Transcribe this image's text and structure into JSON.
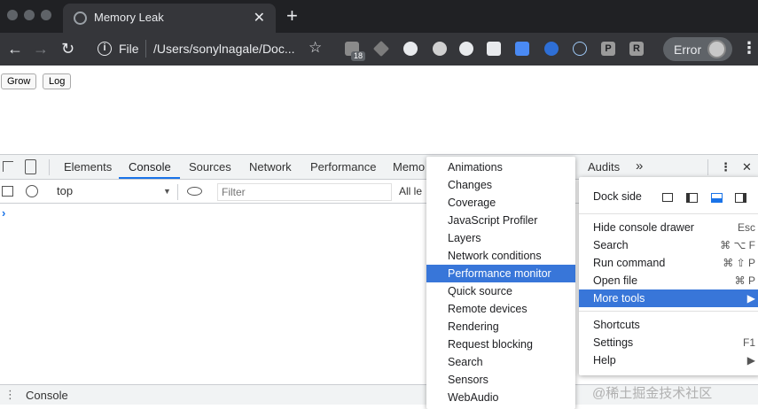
{
  "browser": {
    "tab_title": "Memory Leak",
    "tab_close": "✕",
    "new_tab": "+",
    "nav": {
      "back": "←",
      "forward": "→",
      "reload": "↻"
    },
    "info_icon_glyph": "i",
    "address_scheme": "File",
    "address_url": "/Users/sonylnagale/Doc...",
    "star": "☆",
    "ext_badge": "18",
    "error_label": "Error",
    "menu_glyph": "⋮",
    "extension_letters": [
      "P",
      "R"
    ],
    "colors": {
      "tabbar": "#202124",
      "toolbar": "#35363a"
    }
  },
  "page": {
    "grow_button": "Grow",
    "log_button": "Log"
  },
  "devtools": {
    "tabs": [
      "Elements",
      "Console",
      "Sources",
      "Network",
      "Performance",
      "Memo",
      "Audits"
    ],
    "more_tabs": "»",
    "active_tab": "Console",
    "context": "top",
    "filter_placeholder": "Filter",
    "levels": "All le",
    "prompt": "›",
    "drawer_label": "Console",
    "drawer_menu": "⋮",
    "close": "✕",
    "menu": "⋮"
  },
  "more_tools_submenu": {
    "items": [
      "Animations",
      "Changes",
      "Coverage",
      "JavaScript Profiler",
      "Layers",
      "Network conditions",
      "Performance monitor",
      "Quick source",
      "Remote devices",
      "Rendering",
      "Request blocking",
      "Search",
      "Sensors",
      "WebAudio"
    ],
    "highlighted": "Performance monitor"
  },
  "main_menu": {
    "dock_side_label": "Dock side",
    "items": [
      {
        "label": "Hide console drawer",
        "shortcut": "Esc"
      },
      {
        "label": "Search",
        "shortcut": "⌘ ⌥ F"
      },
      {
        "label": "Run command",
        "shortcut": "⌘ ⇧ P"
      },
      {
        "label": "Open file",
        "shortcut": "⌘ P"
      },
      {
        "label": "More tools",
        "shortcut": "▶"
      },
      {
        "label": "Shortcuts",
        "shortcut": ""
      },
      {
        "label": "Settings",
        "shortcut": "F1"
      },
      {
        "label": "Help",
        "shortcut": "▶"
      }
    ],
    "highlighted": "More tools",
    "accent": "#3876d9"
  },
  "watermark": "@稀土掘金技术社区"
}
